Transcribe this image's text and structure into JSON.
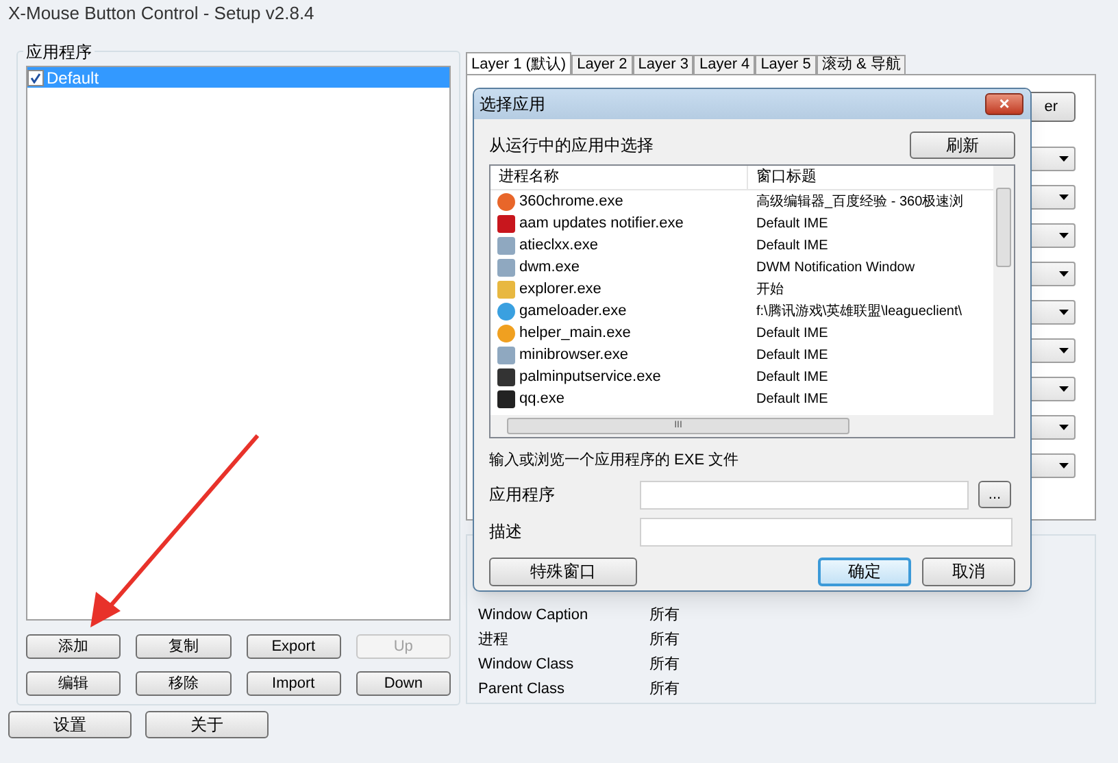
{
  "window": {
    "title": "X-Mouse Button Control - Setup v2.8.4"
  },
  "applications": {
    "label": "应用程序",
    "items": [
      {
        "label": "Default",
        "checked": true,
        "selected": true
      }
    ],
    "buttons": [
      {
        "label": "添加",
        "disabled": false
      },
      {
        "label": "复制",
        "disabled": false
      },
      {
        "label": "Export",
        "disabled": false
      },
      {
        "label": "Up",
        "disabled": true
      },
      {
        "label": "编辑",
        "disabled": false
      },
      {
        "label": "移除",
        "disabled": false
      },
      {
        "label": "Import",
        "disabled": false
      },
      {
        "label": "Down",
        "disabled": false
      }
    ]
  },
  "bottom_buttons": [
    "设置",
    "关于"
  ],
  "tabs": [
    {
      "label": "Layer 1 (默认)",
      "selected": true
    },
    {
      "label": "Layer 2",
      "selected": false
    },
    {
      "label": "Layer 3",
      "selected": false
    },
    {
      "label": "Layer 4",
      "selected": false
    },
    {
      "label": "Layer 5",
      "selected": false
    },
    {
      "label": "滚动 & 导航",
      "selected": false
    }
  ],
  "layer_panel": {
    "button": "er"
  },
  "filter_info": [
    {
      "label": "Window Caption",
      "value": "所有"
    },
    {
      "label": "进程",
      "value": "所有"
    },
    {
      "label": "Window Class",
      "value": "所有"
    },
    {
      "label": "Parent Class",
      "value": "所有"
    }
  ],
  "dialog": {
    "title": "选择应用",
    "close": "×",
    "section_label": "从运行中的应用中选择",
    "refresh_button": "刷新",
    "columns": [
      "进程名称",
      "窗口标题"
    ],
    "rows": [
      {
        "name": "360chrome.exe",
        "title": "高级编辑器_百度经验 - 360极速浏"
      },
      {
        "name": "aam updates notifier.exe",
        "title": "Default IME"
      },
      {
        "name": "atieclxx.exe",
        "title": "Default IME"
      },
      {
        "name": "dwm.exe",
        "title": "DWM Notification Window"
      },
      {
        "name": "explorer.exe",
        "title": "开始"
      },
      {
        "name": "gameloader.exe",
        "title": "f:\\腾讯游戏\\英雄联盟\\leagueclient\\"
      },
      {
        "name": "helper_main.exe",
        "title": "Default IME"
      },
      {
        "name": "minibrowser.exe",
        "title": "Default IME"
      },
      {
        "name": "palminputservice.exe",
        "title": "Default IME"
      },
      {
        "name": "qq.exe",
        "title": "Default IME"
      }
    ],
    "scroll_grip": "III",
    "exe_label": "输入或浏览一个应用程序的 EXE 文件",
    "fields": [
      {
        "label": "应用程序",
        "browse": "..."
      },
      {
        "label": "描述"
      }
    ],
    "buttons": [
      {
        "label": "特殊窗口",
        "default": false
      },
      {
        "label": "确定",
        "default": true
      },
      {
        "label": "取消",
        "default": false
      }
    ]
  }
}
